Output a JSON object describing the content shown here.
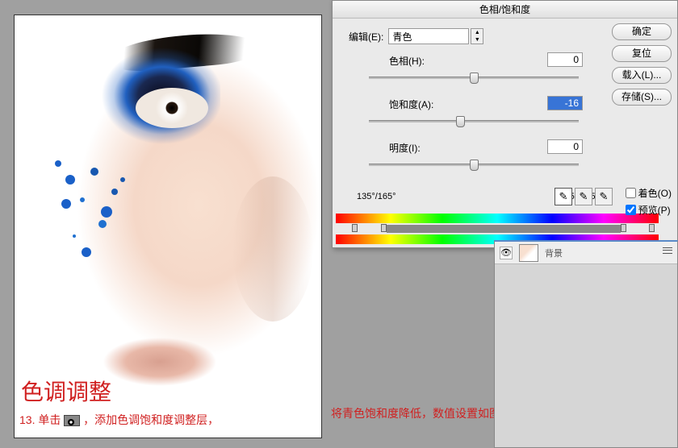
{
  "dialog": {
    "title": "色相/饱和度",
    "edit_label": "编辑(E):",
    "edit_value": "青色",
    "hue": {
      "label": "色相(H):",
      "value": "0",
      "pos": 125
    },
    "sat": {
      "label": "饱和度(A):",
      "value": "-16",
      "pos": 108
    },
    "light": {
      "label": "明度(I):",
      "value": "0",
      "pos": 125
    },
    "degrees_left": "135°/165°",
    "degrees_right": "195°\\225°",
    "buttons": {
      "ok": "确定",
      "reset": "复位",
      "load": "载入(L)...",
      "save": "存储(S)..."
    },
    "colorize": "着色(O)",
    "preview": "预览(P)"
  },
  "image": {
    "title": "色调调整",
    "caption_prefix": "13. 单击",
    "caption_mid": "，添加色调饱和度调整层，",
    "caption_right": "将青色饱和度降低，数值设置如图所示。"
  },
  "layers": {
    "name": "背景"
  }
}
